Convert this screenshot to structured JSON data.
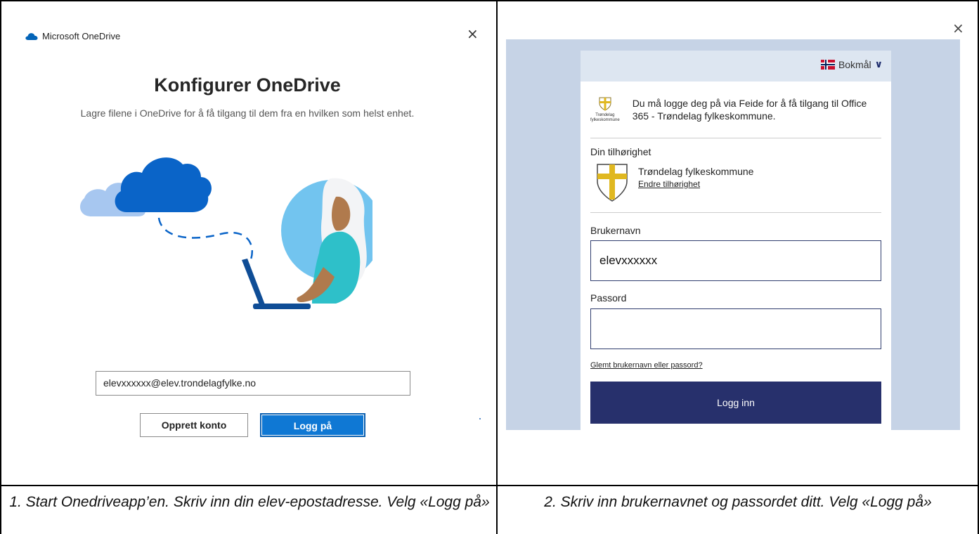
{
  "onedrive": {
    "brand": "Microsoft OneDrive",
    "close": "×",
    "title": "Konfigurer OneDrive",
    "subtitle": "Lagre filene i OneDrive for å få tilgang til dem fra en hvilken som helst enhet.",
    "email_value": "elevxxxxxx@elev.trondelagfylke.no",
    "create_label": "Opprett konto",
    "signin_label": "Logg på",
    "accent": "#0f78d4"
  },
  "feide": {
    "close": "×",
    "language": "Bokmål",
    "intro": "Du må logge deg på via Feide for å få tilgang til Office 365 - Trøndelag fylkeskommune.",
    "logo_text": "Trøndelag fylkeskommune",
    "affiliation_title": "Din tilhørighet",
    "affiliation_name": "Trøndelag fylkeskommune",
    "change_affiliation": "Endre tilhørighet",
    "username_label": "Brukernavn",
    "username_value": "elevxxxxxx",
    "password_label": "Passord",
    "password_value": "",
    "forgot_link": "Glemt brukernavn eller passord?",
    "submit_label": "Logg inn",
    "accent": "#27306c"
  },
  "captions": {
    "step1": "1. Start Onedriveapp’en. Skriv inn din elev-epostadresse. Velg «Logg på»",
    "step2": "2. Skriv inn brukernavnet og passordet ditt. Velg «Logg på»"
  }
}
